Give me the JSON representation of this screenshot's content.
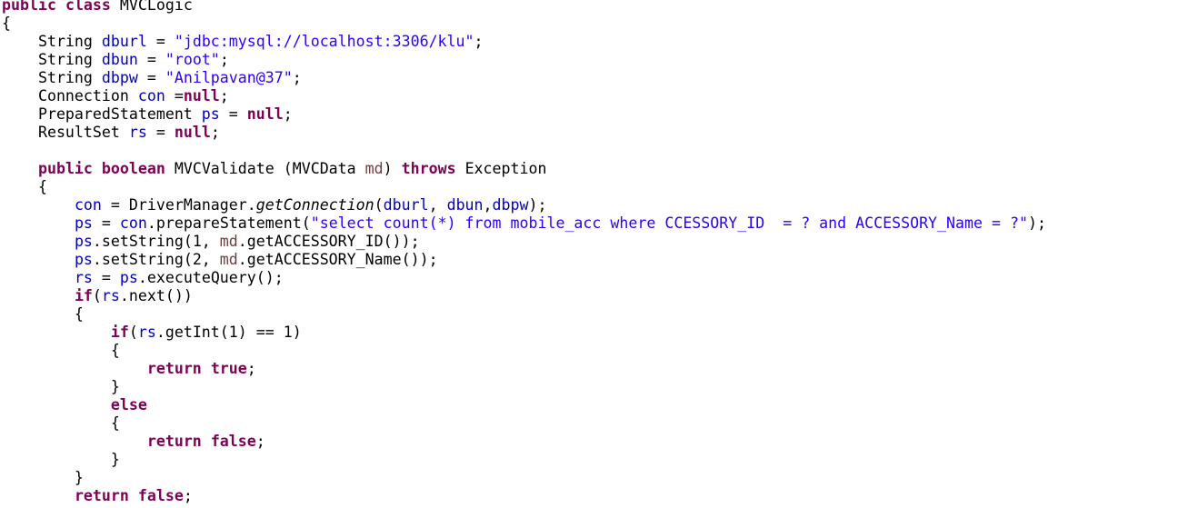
{
  "editor": {
    "lines": [
      [
        {
          "t": "public",
          "c": "kw"
        },
        {
          "t": " "
        },
        {
          "t": "class",
          "c": "kw"
        },
        {
          "t": " MVCLogic"
        }
      ],
      [
        {
          "t": "{"
        }
      ],
      [
        {
          "t": "    String "
        },
        {
          "t": "dburl",
          "c": "fld"
        },
        {
          "t": " = "
        },
        {
          "t": "\"jdbc:mysql://localhost:3306/klu\"",
          "c": "str"
        },
        {
          "t": ";"
        }
      ],
      [
        {
          "t": "    String "
        },
        {
          "t": "dbun",
          "c": "fld"
        },
        {
          "t": " = "
        },
        {
          "t": "\"root\"",
          "c": "str"
        },
        {
          "t": ";"
        }
      ],
      [
        {
          "t": "    String "
        },
        {
          "t": "dbpw",
          "c": "fld"
        },
        {
          "t": " = "
        },
        {
          "t": "\"Anilpavan@37\"",
          "c": "str"
        },
        {
          "t": ";"
        }
      ],
      [
        {
          "t": "    Connection "
        },
        {
          "t": "con",
          "c": "fld"
        },
        {
          "t": " ="
        },
        {
          "t": "null",
          "c": "kw"
        },
        {
          "t": ";"
        }
      ],
      [
        {
          "t": "    PreparedStatement "
        },
        {
          "t": "ps",
          "c": "fld"
        },
        {
          "t": " = "
        },
        {
          "t": "null",
          "c": "kw"
        },
        {
          "t": ";"
        }
      ],
      [
        {
          "t": "    ResultSet "
        },
        {
          "t": "rs",
          "c": "fld"
        },
        {
          "t": " = "
        },
        {
          "t": "null",
          "c": "kw"
        },
        {
          "t": ";"
        }
      ],
      [
        {
          "t": ""
        }
      ],
      [
        {
          "t": "    "
        },
        {
          "t": "public",
          "c": "kw"
        },
        {
          "t": " "
        },
        {
          "t": "boolean",
          "c": "kw"
        },
        {
          "t": " MVCValidate (MVCData "
        },
        {
          "t": "md",
          "c": "lv"
        },
        {
          "t": ") "
        },
        {
          "t": "throws",
          "c": "kw"
        },
        {
          "t": " Exception"
        }
      ],
      [
        {
          "t": "    {"
        }
      ],
      [
        {
          "t": "        "
        },
        {
          "t": "con",
          "c": "fld"
        },
        {
          "t": " = DriverManager."
        },
        {
          "t": "getConnection",
          "c": "it"
        },
        {
          "t": "("
        },
        {
          "t": "dburl",
          "c": "fld"
        },
        {
          "t": ", "
        },
        {
          "t": "dbun",
          "c": "fld"
        },
        {
          "t": ","
        },
        {
          "t": "dbpw",
          "c": "fld"
        },
        {
          "t": ");"
        }
      ],
      [
        {
          "t": "        "
        },
        {
          "t": "ps",
          "c": "fld"
        },
        {
          "t": " = "
        },
        {
          "t": "con",
          "c": "fld"
        },
        {
          "t": ".prepareStatement("
        },
        {
          "t": "\"select count(*) from mobile_acc where CCESSORY_ID  = ? and ACCESSORY_Name = ?\"",
          "c": "str"
        },
        {
          "t": ");"
        }
      ],
      [
        {
          "t": "        "
        },
        {
          "t": "ps",
          "c": "fld"
        },
        {
          "t": ".setString(1, "
        },
        {
          "t": "md",
          "c": "lv"
        },
        {
          "t": ".getACCESSORY_ID());"
        }
      ],
      [
        {
          "t": "        "
        },
        {
          "t": "ps",
          "c": "fld"
        },
        {
          "t": ".setString(2, "
        },
        {
          "t": "md",
          "c": "lv"
        },
        {
          "t": ".getACCESSORY_Name());"
        }
      ],
      [
        {
          "t": "        "
        },
        {
          "t": "rs",
          "c": "fld"
        },
        {
          "t": " = "
        },
        {
          "t": "ps",
          "c": "fld"
        },
        {
          "t": ".executeQuery();"
        }
      ],
      [
        {
          "t": "        "
        },
        {
          "t": "if",
          "c": "kw"
        },
        {
          "t": "("
        },
        {
          "t": "rs",
          "c": "fld"
        },
        {
          "t": ".next())"
        }
      ],
      [
        {
          "t": "        {"
        }
      ],
      [
        {
          "t": "            "
        },
        {
          "t": "if",
          "c": "kw"
        },
        {
          "t": "("
        },
        {
          "t": "rs",
          "c": "fld"
        },
        {
          "t": ".getInt(1) == 1)"
        }
      ],
      [
        {
          "t": "            {"
        }
      ],
      [
        {
          "t": "                "
        },
        {
          "t": "return",
          "c": "kw"
        },
        {
          "t": " "
        },
        {
          "t": "true",
          "c": "kw"
        },
        {
          "t": ";"
        }
      ],
      [
        {
          "t": "            }"
        }
      ],
      [
        {
          "t": "            "
        },
        {
          "t": "else",
          "c": "kw"
        }
      ],
      [
        {
          "t": "            {"
        }
      ],
      [
        {
          "t": "                "
        },
        {
          "t": "return",
          "c": "kw"
        },
        {
          "t": " "
        },
        {
          "t": "false",
          "c": "kw"
        },
        {
          "t": ";"
        }
      ],
      [
        {
          "t": "            }"
        }
      ],
      [
        {
          "t": "        }"
        }
      ],
      [
        {
          "t": "        "
        },
        {
          "t": "return",
          "c": "kw"
        },
        {
          "t": " "
        },
        {
          "t": "false",
          "c": "kw"
        },
        {
          "t": ";"
        }
      ]
    ]
  }
}
